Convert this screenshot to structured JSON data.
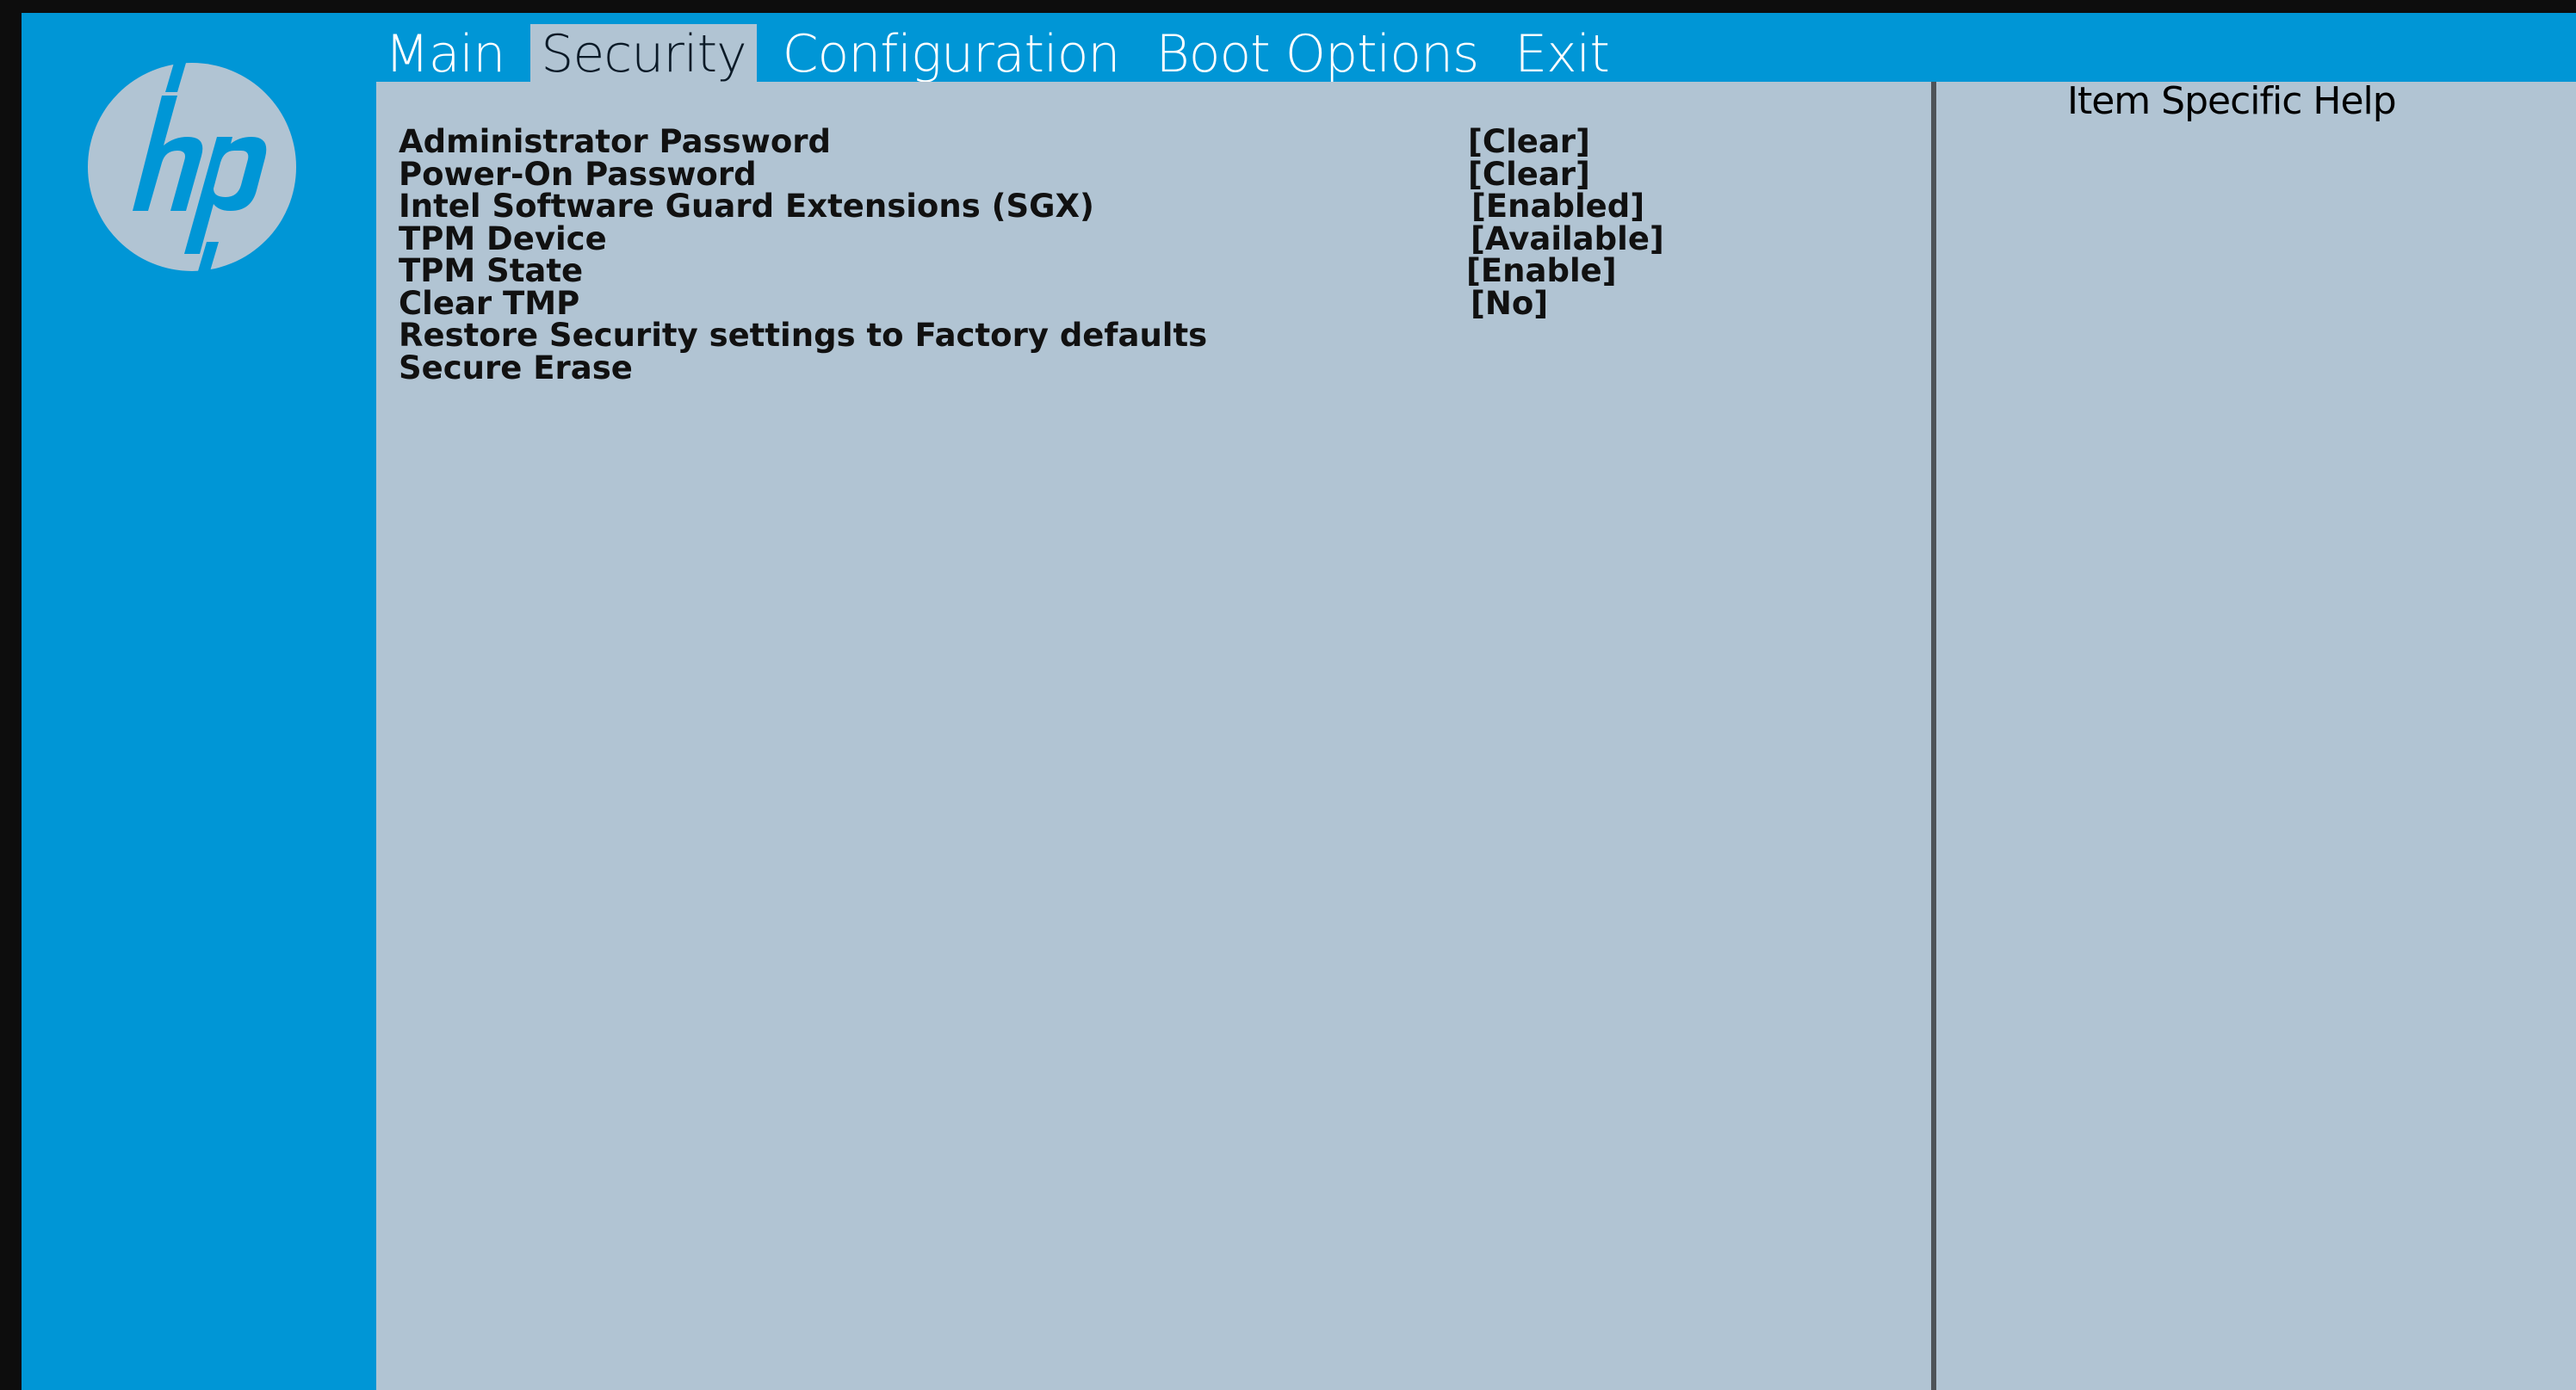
{
  "brand": {
    "logo_icon": "hp-logo-icon",
    "colors": {
      "frame_blue": "#0096d6",
      "panel_gray": "#b1c4d3",
      "divider": "#4e5358"
    }
  },
  "menu": {
    "items": [
      {
        "label": "Main",
        "active": false
      },
      {
        "label": "Security",
        "active": true
      },
      {
        "label": "Configuration",
        "active": false
      },
      {
        "label": "Boot Options",
        "active": false
      },
      {
        "label": "Exit",
        "active": false
      }
    ]
  },
  "settings": {
    "rows": [
      {
        "label": "Administrator Password",
        "value": "[Clear]"
      },
      {
        "label": "Power-On Password",
        "value": "[Clear]"
      },
      {
        "label": "Intel Software Guard Extensions (SGX)",
        "value": "[Enabled]"
      },
      {
        "label": "TPM Device",
        "value": "[Available]"
      },
      {
        "label": "TPM State",
        "value": "[Enable]"
      },
      {
        "label": "Clear TMP",
        "value": "[No]"
      },
      {
        "label": "Restore Security settings to Factory defaults",
        "value": ""
      },
      {
        "label": "Secure Erase",
        "value": ""
      }
    ]
  },
  "help": {
    "title": "Item Specific Help"
  }
}
